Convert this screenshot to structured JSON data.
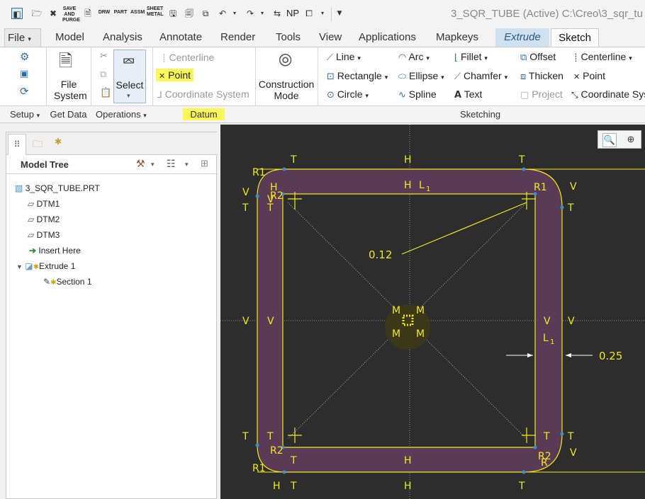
{
  "window": {
    "title": "3_SQR_TUBE (Active) C:\\Creo\\3_sqr_tu"
  },
  "quick_access": {
    "save_purge": "SAVE AND PURGE",
    "drw": "DRW",
    "part": "PART",
    "assm": "ASSM",
    "sheet_metal": "SHEET METAL",
    "np": "NP"
  },
  "tabs": {
    "file": "File",
    "items": [
      "Model",
      "Analysis",
      "Annotate",
      "Render",
      "Tools",
      "View",
      "Applications",
      "Mapkeys"
    ],
    "extrude": "Extrude",
    "sketch": "Sketch"
  },
  "ribbon": {
    "file_system": "File System",
    "select": "Select",
    "datum": {
      "centerline": "Centerline",
      "point": "Point",
      "coordinate_system": "Coordinate System"
    },
    "construction_mode": "Construction Mode",
    "sketching": {
      "line": "Line",
      "arc": "Arc",
      "fillet": "Fillet",
      "offset": "Offset",
      "centerline": "Centerline",
      "rectangle": "Rectangle",
      "ellipse": "Ellipse",
      "chamfer": "Chamfer",
      "thicken": "Thicken",
      "point": "Point",
      "circle": "Circle",
      "spline": "Spline",
      "text": "Text",
      "project": "Project",
      "coordinate_system": "Coordinate Sys"
    },
    "groups": {
      "setup": "Setup",
      "get_data": "Get Data",
      "operations": "Operations",
      "datum": "Datum",
      "sketching": "Sketching"
    }
  },
  "model_tree": {
    "title": "Model Tree",
    "items": [
      "3_SQR_TUBE.PRT",
      "DTM1",
      "DTM2",
      "DTM3",
      "Insert Here",
      "Extrude 1",
      "Section 1"
    ]
  },
  "sketch": {
    "dimension_thickness": "0.12",
    "dimension_offset": "0.25",
    "constraints": {
      "h": "H",
      "v": "V",
      "t": "T",
      "m": "M",
      "l1": "L",
      "l1_sub": "1",
      "r1": "R1",
      "r2": "R2",
      "r": "R"
    }
  },
  "colors": {
    "highlight": "#fbf75a",
    "sketch": "#f1ea1e",
    "fill": "#5b3a56",
    "canvas": "#2d2d2d",
    "accent": "#2d6ea8"
  }
}
